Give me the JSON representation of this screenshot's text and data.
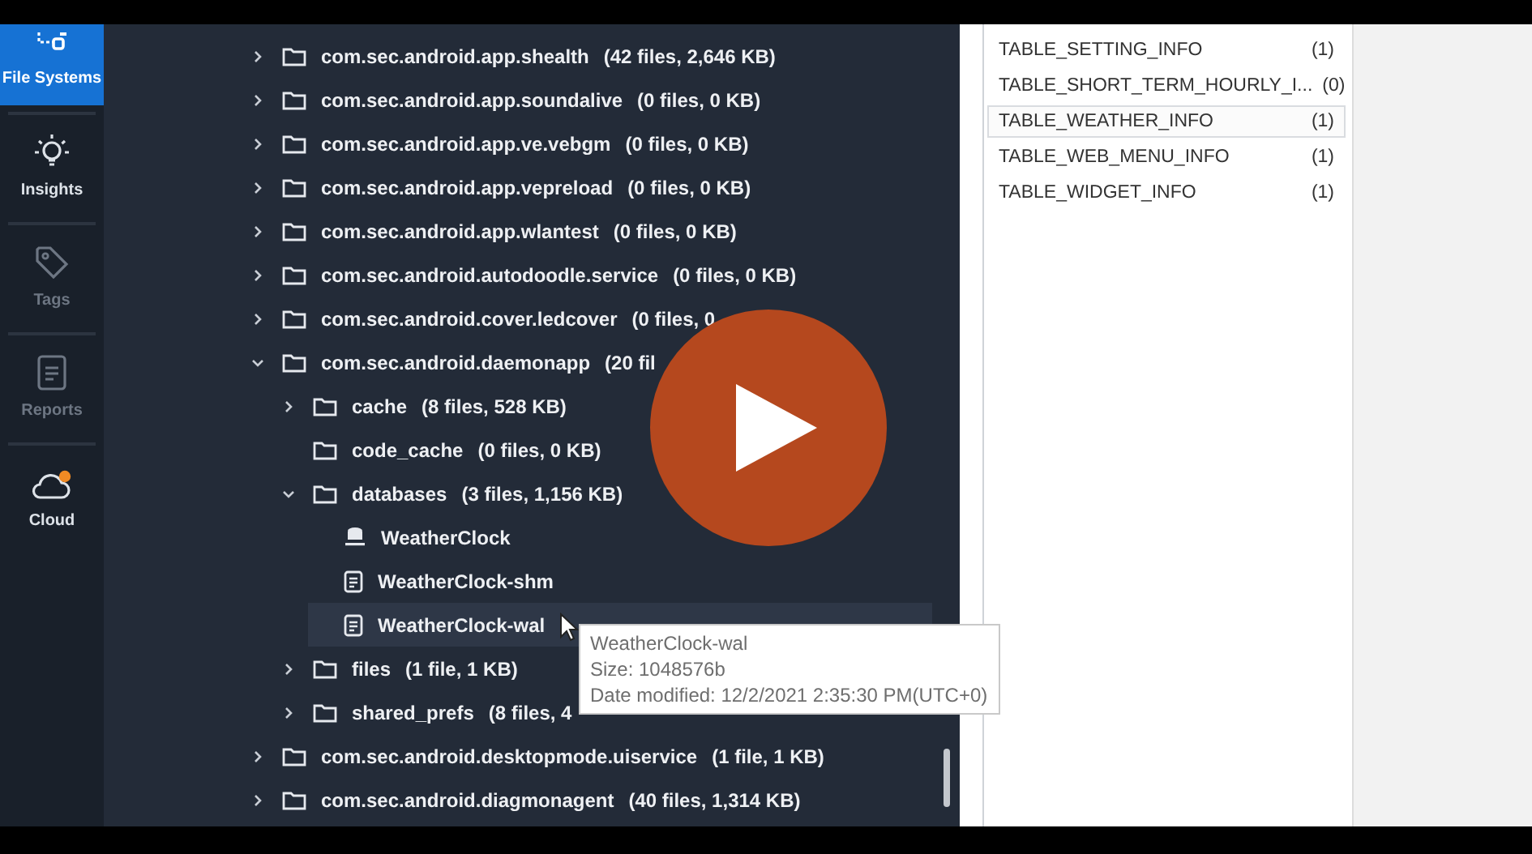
{
  "sidebar": {
    "items": [
      {
        "label": "File Systems",
        "selected": true,
        "disabled": false
      },
      {
        "label": "Insights",
        "selected": false,
        "disabled": false
      },
      {
        "label": "Tags",
        "selected": false,
        "disabled": true
      },
      {
        "label": "Reports",
        "selected": false,
        "disabled": true
      },
      {
        "label": "Cloud",
        "selected": false,
        "disabled": false
      }
    ]
  },
  "tree": [
    {
      "kind": "folder",
      "name": "com.sec.android.app.shealth",
      "count": "(42 files, 2,646 KB)",
      "expanded": false
    },
    {
      "kind": "folder",
      "name": "com.sec.android.app.soundalive",
      "count": "(0 files, 0 KB)",
      "expanded": false
    },
    {
      "kind": "folder",
      "name": "com.sec.android.app.ve.vebgm",
      "count": "(0 files, 0 KB)",
      "expanded": false
    },
    {
      "kind": "folder",
      "name": "com.sec.android.app.vepreload",
      "count": "(0 files, 0 KB)",
      "expanded": false
    },
    {
      "kind": "folder",
      "name": "com.sec.android.app.wlantest",
      "count": "(0 files, 0 KB)",
      "expanded": false
    },
    {
      "kind": "folder",
      "name": "com.sec.android.autodoodle.service",
      "count": "(0 files, 0 KB)",
      "expanded": false
    },
    {
      "kind": "folder",
      "name": "com.sec.android.cover.ledcover",
      "count": "(0 files, 0",
      "expanded": false
    },
    {
      "kind": "folder",
      "name": "com.sec.android.daemonapp",
      "count": "(20 fil",
      "expanded": true,
      "children": [
        {
          "kind": "folder",
          "name": "cache",
          "count": "(8 files, 528 KB)",
          "expanded": false
        },
        {
          "kind": "folder",
          "name": "code_cache",
          "count": "(0 files, 0 KB)"
        },
        {
          "kind": "folder",
          "name": "databases",
          "count": "(3 files, 1,156 KB)",
          "expanded": true,
          "children": [
            {
              "kind": "database",
              "name": "WeatherClock",
              "selected": false
            },
            {
              "kind": "file",
              "name": "WeatherClock-shm",
              "selected": false
            },
            {
              "kind": "file",
              "name": "WeatherClock-wal",
              "selected": true
            }
          ]
        },
        {
          "kind": "folder",
          "name": "files",
          "count": "(1 file, 1 KB)",
          "expanded": false
        },
        {
          "kind": "folder",
          "name": "shared_prefs",
          "count": "(8 files, 4",
          "expanded": false
        }
      ]
    },
    {
      "kind": "folder",
      "name": "com.sec.android.desktopmode.uiservice",
      "count": "(1 file, 1 KB)",
      "expanded": false
    },
    {
      "kind": "folder",
      "name": "com.sec.android.diagmonagent",
      "count": "(40 files, 1,314 KB)",
      "expanded": false
    }
  ],
  "tooltip": {
    "title": "WeatherClock-wal",
    "size": "Size: 1048576b",
    "date": "Date modified: 12/2/2021 2:35:30 PM(UTC+0)"
  },
  "tables": [
    {
      "name": "TABLE_SETTING_INFO",
      "count": "(1)",
      "selected": false
    },
    {
      "name": "TABLE_SHORT_TERM_HOURLY_I...",
      "count": "(0)",
      "selected": false
    },
    {
      "name": "TABLE_WEATHER_INFO",
      "count": "(1)",
      "selected": true
    },
    {
      "name": "TABLE_WEB_MENU_INFO",
      "count": "(1)",
      "selected": false
    },
    {
      "name": "TABLE_WIDGET_INFO",
      "count": "(1)",
      "selected": false
    }
  ]
}
